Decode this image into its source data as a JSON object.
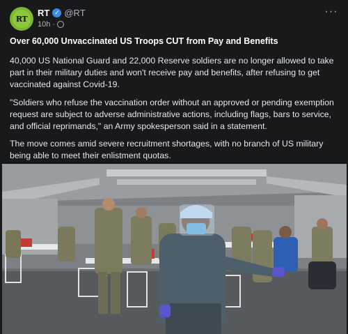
{
  "post": {
    "author": "RT",
    "handle": "@RT",
    "time": "10h",
    "avatar_text": "RT",
    "more": "···",
    "title": "Over 60,000 Unvaccinated US Troops CUT from Pay and Benefits",
    "paragraphs": [
      "40,000 US National Guard and 22,000 Reserve soldiers are no longer allowed to take part in their military duties and won't receive pay and benefits, after refusing to get vaccinated against Covid-19.",
      "\"Soldiers who refuse the vaccination order without an approved or pending exemption request are subject to adverse administrative actions, including flags, bars to service, and official reprimands,\" an Army spokesperson said in a statement.",
      "The move comes amid severe recruitment shortages, with no branch of US military being able to meet their enlistment quotas."
    ]
  },
  "colors": {
    "background": "#18191a",
    "text": "#e4e6eb",
    "secondary_text": "#b0b3b8",
    "verified_badge": "#3a8de0",
    "avatar_green": "#8dc63f"
  },
  "icons": {
    "verified": "verified-badge-icon",
    "visibility": "globe-icon",
    "more": "more-options-icon"
  }
}
